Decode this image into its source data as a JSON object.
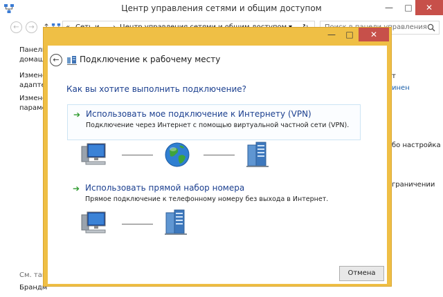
{
  "window": {
    "title": "Центр управления сетями и общим доступом",
    "controls": {
      "minimize": "—",
      "maximize": "□",
      "close": "✕"
    }
  },
  "addressbar": {
    "back": "←",
    "forward": "→",
    "up": "↑",
    "chevron_left": "«",
    "crumb1": "Сеть и ...",
    "separator": "›",
    "crumb2": "Центр управления сетями и общим доступом",
    "dropdown": "▾",
    "refresh": "↻",
    "search_placeholder": "Поиск в панели управления"
  },
  "background_left": {
    "l1": "Панель",
    "l2": "домаш",
    "l3": "Измене",
    "l4": "адаптер",
    "l5": "Измене",
    "l6": "параме",
    "see_also": "См. так",
    "l8": "Брандм"
  },
  "background_right": {
    "r1": "т",
    "r2": "инен",
    "r3": "бо настройка",
    "r4": "граничении"
  },
  "dialog": {
    "title": "Подключение к рабочему месту",
    "controls": {
      "minimize": "—",
      "maximize": "□",
      "close": "✕"
    },
    "back_glyph": "←",
    "question": "Как вы хотите выполнить подключение?",
    "options": [
      {
        "arrow": "➔",
        "title": "Использовать мое подключение к Интернету (VPN)",
        "description": "Подключение через Интернет с помощью виртуальной частной сети (VPN)."
      },
      {
        "arrow": "➔",
        "title": "Использовать прямой набор номера",
        "description": "Прямое подключение к телефонному номеру без выхода в Интернет."
      }
    ],
    "cancel_label": "Отмена"
  },
  "colors": {
    "dialog_frame": "#efbf45",
    "link_blue": "#1b3f8f",
    "close_red": "#c7504a",
    "arrow_green": "#2f9b2f"
  },
  "icons": [
    "network-center-icon",
    "search-icon",
    "computer-icon",
    "globe-icon",
    "server-icon"
  ]
}
